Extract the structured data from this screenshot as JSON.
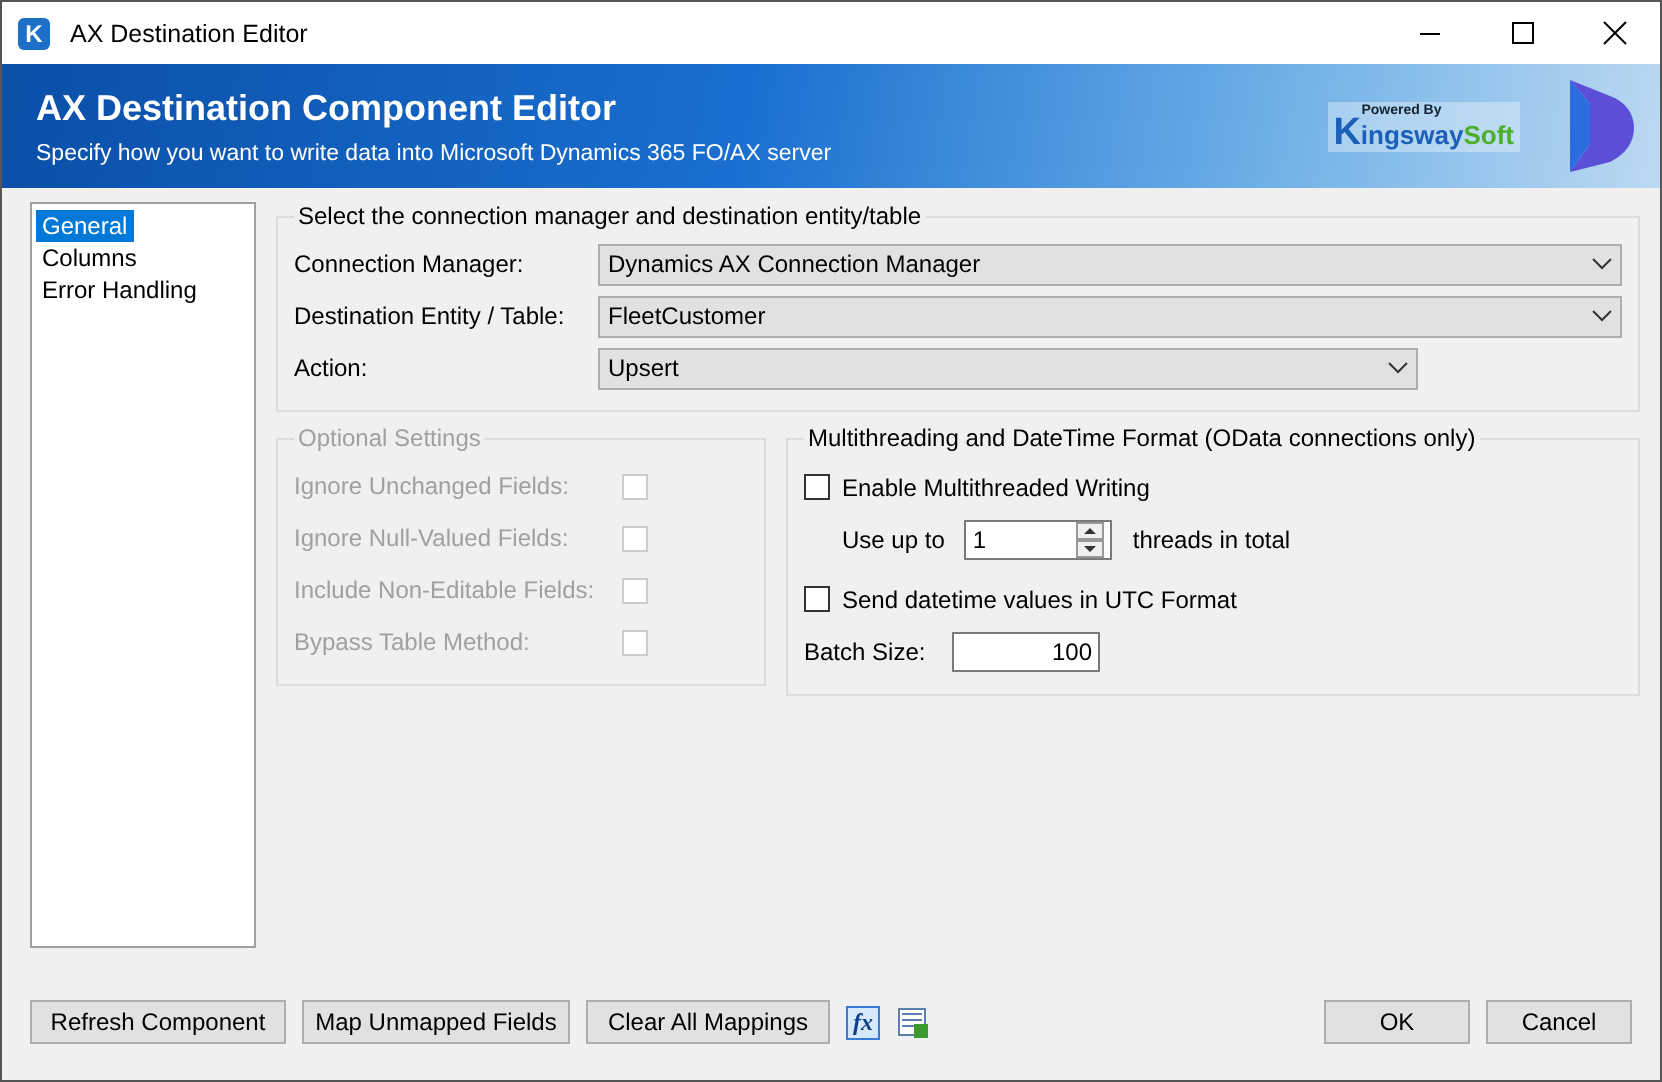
{
  "window": {
    "title": "AX Destination Editor",
    "icon_letter": "K"
  },
  "banner": {
    "title": "AX Destination Component Editor",
    "subtitle": "Specify how you want to write data into Microsoft Dynamics 365 FO/AX server",
    "logo": {
      "powered_by": "Powered By",
      "initial": "K",
      "name": "ingsway",
      "name_accent": "Soft"
    }
  },
  "nav": {
    "items": [
      {
        "label": "General",
        "selected": true
      },
      {
        "label": "Columns",
        "selected": false
      },
      {
        "label": "Error Handling",
        "selected": false
      }
    ]
  },
  "connection": {
    "legend": "Select the connection manager and destination entity/table",
    "fields": [
      {
        "label": "Connection Manager:",
        "value": "Dynamics AX Connection Manager",
        "wide": true
      },
      {
        "label": "Destination Entity / Table:",
        "value": "FleetCustomer",
        "wide": true
      },
      {
        "label": "Action:",
        "value": "Upsert",
        "wide": false
      }
    ]
  },
  "optional": {
    "legend": "Optional Settings",
    "disabled": true,
    "options": [
      {
        "label": "Ignore Unchanged Fields:",
        "checked": false
      },
      {
        "label": "Ignore Null-Valued Fields:",
        "checked": false
      },
      {
        "label": "Include Non-Editable Fields:",
        "checked": false
      },
      {
        "label": "Bypass Table Method:",
        "checked": false
      }
    ]
  },
  "threading": {
    "legend": "Multithreading and DateTime Format (OData connections only)",
    "multithread": {
      "label": "Enable Multithreaded Writing",
      "checked": false
    },
    "use_up_to": "Use up to",
    "threads": "1",
    "threads_suffix": "threads in total",
    "utc": {
      "label": "Send datetime values in UTC Format",
      "checked": false
    },
    "batch_label": "Batch Size:",
    "batch_size": "100"
  },
  "footer": {
    "buttons": [
      "Refresh Component",
      "Map Unmapped Fields",
      "Clear All Mappings"
    ],
    "fx": "fx",
    "dialog_buttons": [
      "OK",
      "Cancel"
    ]
  }
}
